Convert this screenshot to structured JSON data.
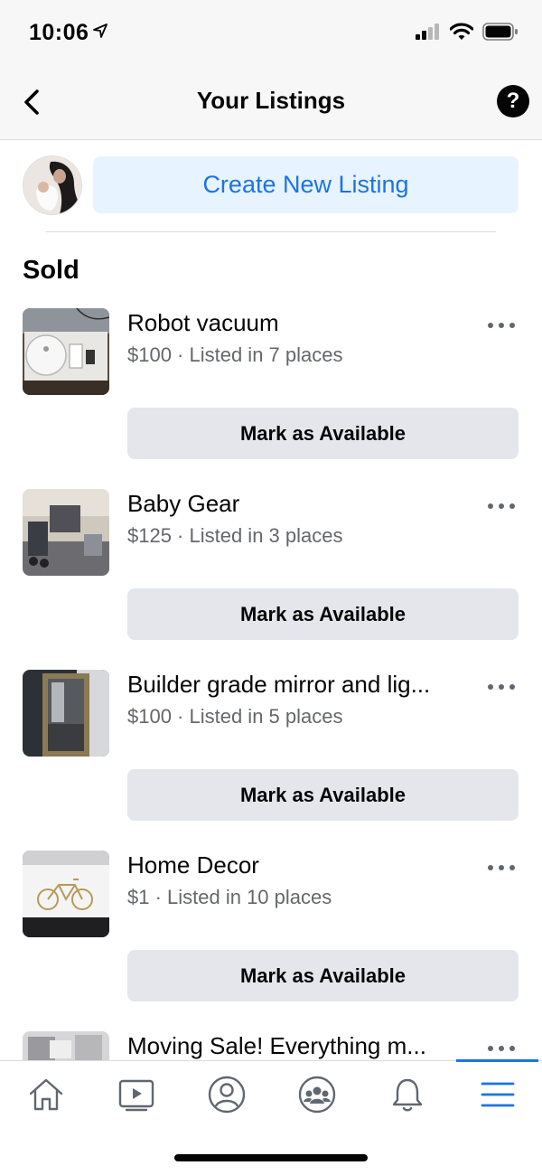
{
  "status_bar": {
    "time": "10:06"
  },
  "header": {
    "title": "Your Listings",
    "help_label": "?"
  },
  "create": {
    "label": "Create New Listing"
  },
  "section": {
    "title": "Sold"
  },
  "listings": [
    {
      "title": "Robot vacuum",
      "subtitle": "$100 · Listed in 7 places",
      "action_label": "Mark as Available",
      "thumb_icon": "robot-vacuum-photo"
    },
    {
      "title": "Baby Gear",
      "subtitle": "$125 · Listed in 3 places",
      "action_label": "Mark as Available",
      "thumb_icon": "baby-gear-photo"
    },
    {
      "title": "Builder grade mirror and lig...",
      "subtitle": "$100 · Listed in 5 places",
      "action_label": "Mark as Available",
      "thumb_icon": "mirror-photo"
    },
    {
      "title": "Home Decor",
      "subtitle": "$1 · Listed in 10 places",
      "action_label": "Mark as Available",
      "thumb_icon": "bicycle-art-photo"
    },
    {
      "title": "Moving Sale! Everything m...",
      "subtitle": "",
      "action_label": "",
      "thumb_icon": "moving-sale-photo"
    }
  ],
  "tabs": [
    {
      "icon": "home-icon"
    },
    {
      "icon": "video-icon"
    },
    {
      "icon": "profile-icon"
    },
    {
      "icon": "groups-icon"
    },
    {
      "icon": "bell-icon"
    },
    {
      "icon": "menu-icon",
      "active": true
    }
  ],
  "colors": {
    "accent": "#1b74e4",
    "create_bg": "#e7f3ff",
    "button_bg": "#e4e6eb",
    "secondary_text": "#65676b"
  }
}
